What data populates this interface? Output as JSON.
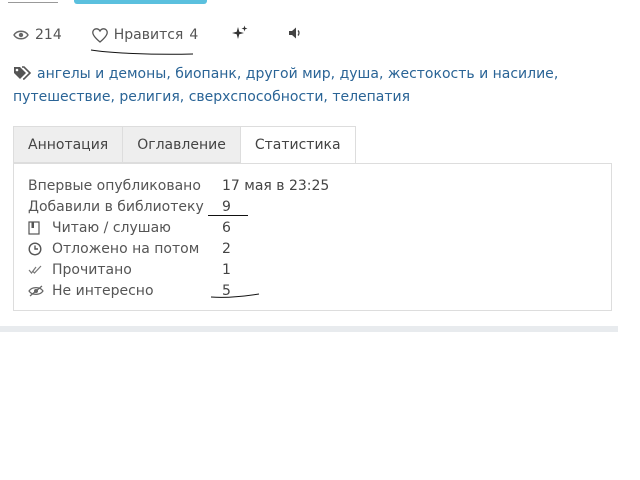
{
  "stats": {
    "views": "214",
    "likes_label": "Нравится",
    "likes_count": "4"
  },
  "tags": [
    "ангелы и демоны",
    "биопанк",
    "другой мир",
    "душа",
    "жестокость и насилие",
    "путешествие",
    "религия",
    "сверхспособности",
    "телепатия"
  ],
  "tabs": [
    {
      "label": "Аннотация",
      "active": false
    },
    {
      "label": "Оглавление",
      "active": false
    },
    {
      "label": "Статистика",
      "active": true
    }
  ],
  "statistics": {
    "first_published": {
      "label": "Впервые опубликовано",
      "value": "17 мая в 23:25"
    },
    "added_to_library": {
      "label": "Добавили в библиотеку",
      "value": "9"
    },
    "reading": {
      "label": "Читаю / слушаю",
      "value": "6",
      "icon": "book-icon"
    },
    "postponed": {
      "label": "Отложено на потом",
      "value": "2",
      "icon": "clock-icon"
    },
    "read": {
      "label": "Прочитано",
      "value": "1",
      "icon": "double-check-icon"
    },
    "not_interested": {
      "label": "Не интересно",
      "value": "5",
      "icon": "eye-slash-icon"
    }
  },
  "colors": {
    "link": "#2a6496",
    "accent_button": "#5bc0de",
    "tab_bg": "#eeeeee",
    "border": "#dddddd"
  }
}
